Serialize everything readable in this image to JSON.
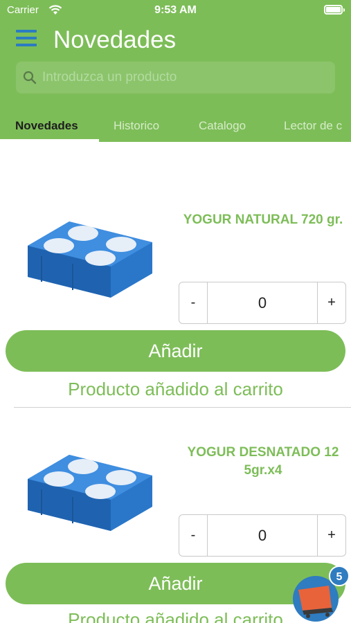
{
  "status_bar": {
    "carrier": "Carrier",
    "time": "9:53 AM"
  },
  "header": {
    "title": "Novedades",
    "search": {
      "placeholder": "Introduzca un producto",
      "value": ""
    }
  },
  "tabs": [
    {
      "label": "Novedades",
      "active": true
    },
    {
      "label": "Historico",
      "active": false
    },
    {
      "label": "Catalogo",
      "active": false
    },
    {
      "label": "Lector de c",
      "active": false
    }
  ],
  "products": [
    {
      "name": "YOGUR NATURAL 720 gr.",
      "quantity": "0",
      "minus_label": "-",
      "plus_label": "+",
      "add_label": "Añadir",
      "added_message": "Producto añadido al carrito"
    },
    {
      "name": "YOGUR DESNATADO 12 5gr.x4",
      "quantity": "0",
      "minus_label": "-",
      "plus_label": "+",
      "add_label": "Añadir",
      "added_message": "Producto añadido al carrito"
    }
  ],
  "cart": {
    "count": "5",
    "icon": "cart-icon"
  },
  "colors": {
    "primary_green": "#7dbd58",
    "accent_blue": "#2b7bc1",
    "tab_inactive": "#d6ecc9"
  }
}
